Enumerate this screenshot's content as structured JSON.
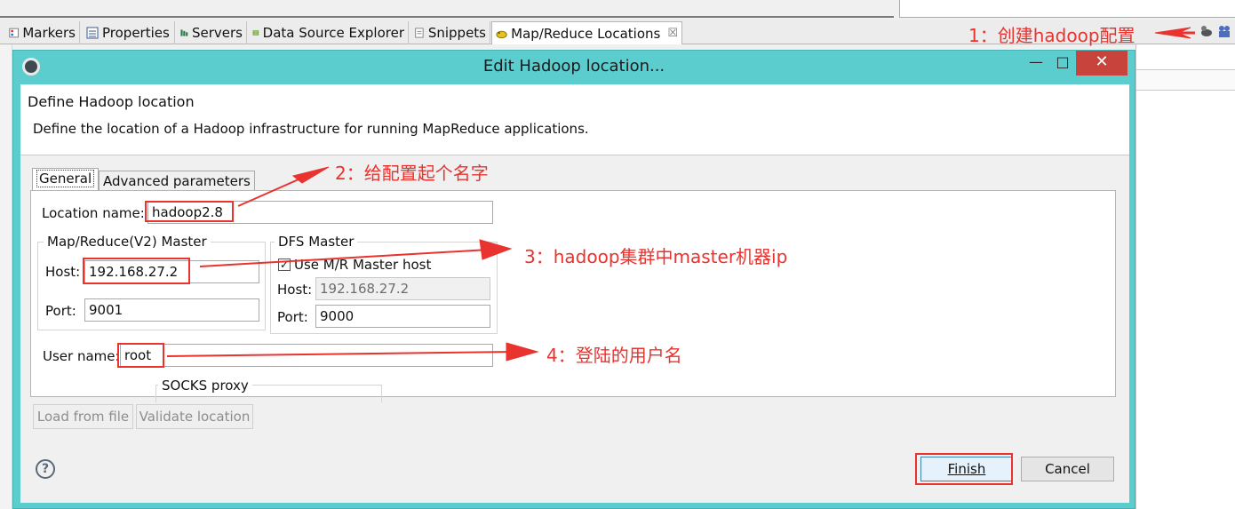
{
  "tabs": [
    {
      "label": "Markers",
      "icon": "markers-icon"
    },
    {
      "label": "Properties",
      "icon": "properties-icon"
    },
    {
      "label": "Servers",
      "icon": "servers-icon"
    },
    {
      "label": "Data Source Explorer",
      "icon": "data-source-icon"
    },
    {
      "label": "Snippets",
      "icon": "snippets-icon"
    },
    {
      "label": "Map/Reduce Locations",
      "icon": "elephant-icon",
      "close": "☒"
    }
  ],
  "dialog": {
    "title": "Edit Hadoop location...",
    "header_title": "Define Hadoop location",
    "header_desc": "Define the location of a Hadoop infrastructure for running MapReduce applications.",
    "tabs": [
      "General",
      "Advanced parameters"
    ],
    "location_label": "Location name:",
    "location_value": "hadoop2.8",
    "mr_group_title": "Map/Reduce(V2) Master",
    "mr_host_label": "Host:",
    "mr_host_value": "192.168.27.2",
    "mr_port_label": "Port:",
    "mr_port_value": "9001",
    "dfs_group_title": "DFS Master",
    "dfs_checkbox_label": "Use M/R Master host",
    "dfs_host_label": "Host:",
    "dfs_host_value": "192.168.27.2",
    "dfs_port_label": "Port:",
    "dfs_port_value": "9000",
    "user_label": "User name:",
    "user_value": "root",
    "socks_group_title": "SOCKS proxy",
    "load_button": "Load from file",
    "validate_button": "Validate location",
    "finish_button": "Finish",
    "cancel_button": "Cancel"
  },
  "annotations": {
    "a1": "1：创建hadoop配置",
    "a2": "2：给配置起个名字",
    "a3": "3：hadoop集群中master机器ip",
    "a4": "4：登陆的用户名"
  },
  "colors": {
    "annotation": "#e8332f",
    "title_bar": "#5bcdcf",
    "close_button": "#c7433b"
  }
}
